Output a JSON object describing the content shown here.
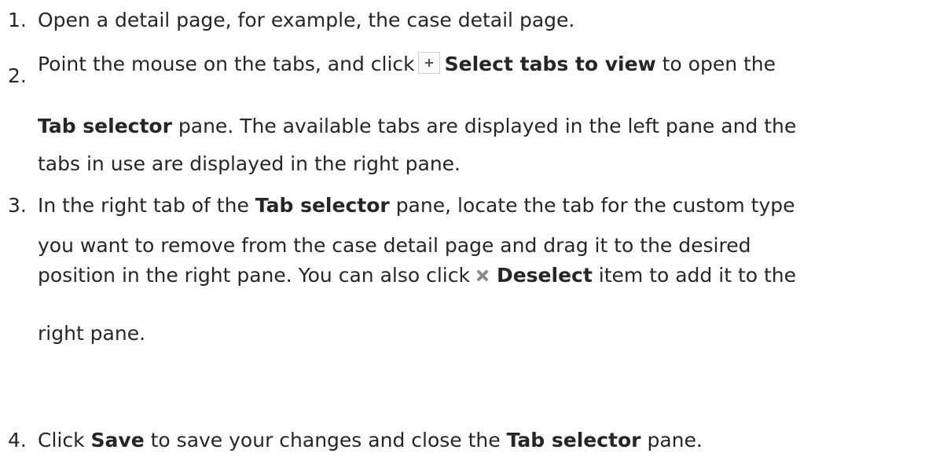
{
  "steps": [
    {
      "number": "1.",
      "text": "Open a detail page, for example, the case detail page."
    },
    {
      "number": "2.",
      "line1_before": "Point the mouse on the tabs, and click",
      "button_label": "Select tabs to view",
      "line1_after": "to open the",
      "line2_bold": "Tab selector",
      "line2_after": "pane. The available tabs are displayed in the left pane and the",
      "line3": "tabs in use are displayed in the right pane.",
      "icon": "plus-icon"
    },
    {
      "number": "3.",
      "line1_before": "In the right tab of the",
      "line1_bold": "Tab selector",
      "line1_after": "pane, locate the tab for the custom type",
      "line2": "you want to remove from the case detail page and drag it to the desired",
      "line3_before": "position in the right pane. You can also click",
      "deselect_label": "Deselect",
      "line3_after": "item to add it to the",
      "line4": "right pane.",
      "icon": "close-icon"
    },
    {
      "number": "4.",
      "before": "Click",
      "save_label": "Save",
      "middle": "to save your changes and close the",
      "bold2": "Tab selector",
      "after": "pane."
    }
  ]
}
